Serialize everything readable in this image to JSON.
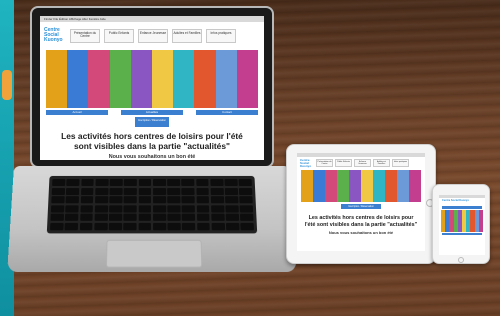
{
  "site": {
    "logo": "Centre Social Kuonyo",
    "menubar": "Finder  File  Édition  Affichage  Aller  Fenêtre  Aide",
    "nav": [
      "Présentation du Centre",
      "Public Enfants",
      "Enfance Jeunesse",
      "Adultes et Familles",
      "Infos pratiques"
    ],
    "buttons": [
      "Accueil",
      "Actualités",
      "Contact"
    ],
    "register_button": "Inscription / Réservation",
    "heading": "Les activités hors centres de loisirs pour l'été sont visibles dans la partie \"actualités\"",
    "subheading": "Nous vous souhaitons un bon été"
  },
  "colors": {
    "accent": "#3b7fd0",
    "photo_strip": [
      "#e3a11a",
      "#3a7bd5",
      "#d34a7a",
      "#5bb04b",
      "#8a56c2",
      "#f0c843",
      "#2fb5c4",
      "#e2572e",
      "#6c9ad8",
      "#c43e8f"
    ]
  },
  "devices": [
    "laptop",
    "tablet",
    "phone"
  ]
}
